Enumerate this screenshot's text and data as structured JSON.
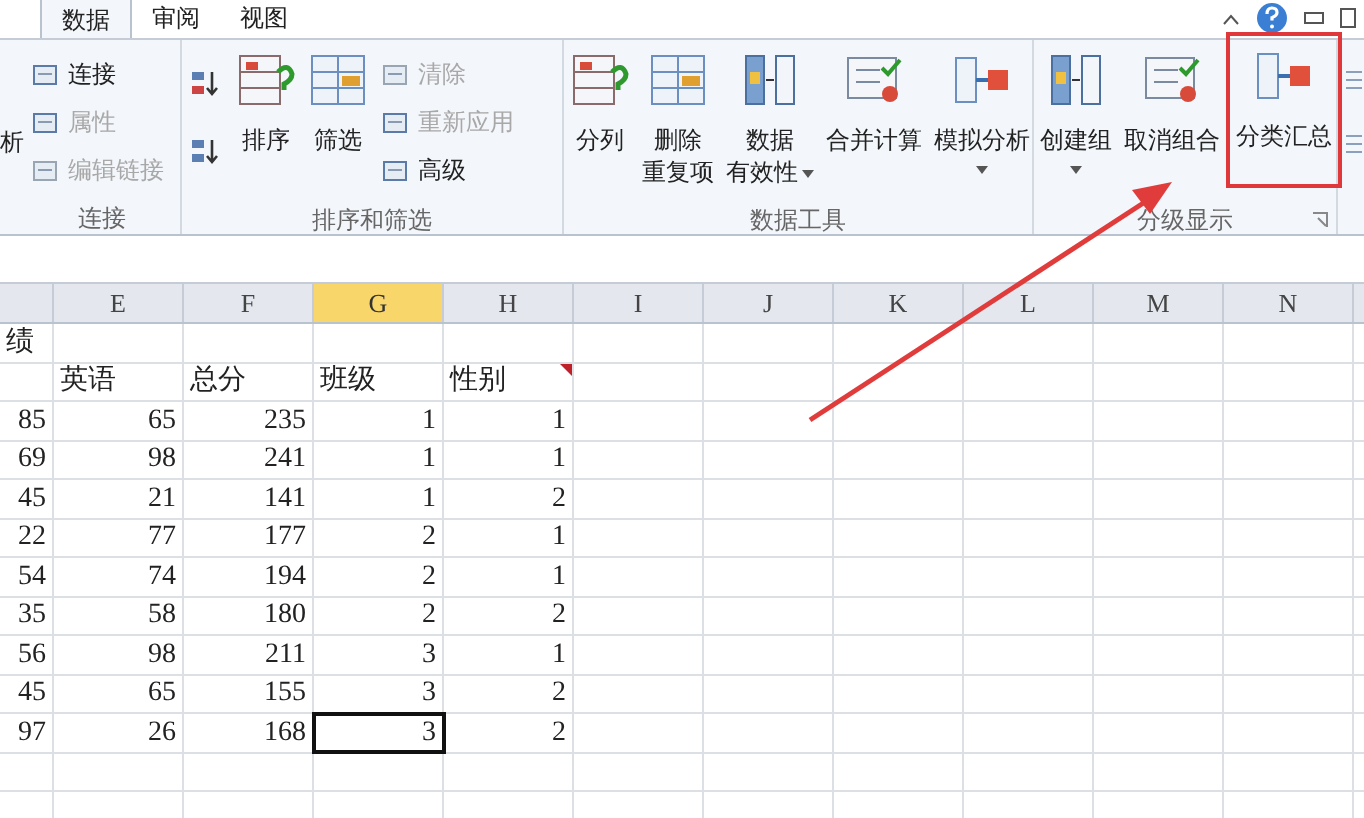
{
  "ribbon": {
    "tabs": [
      {
        "label": "数据",
        "selected": true
      },
      {
        "label": "审阅",
        "selected": false
      },
      {
        "label": "视图",
        "selected": false
      }
    ],
    "cut_label": "析",
    "groups": [
      {
        "label": "连接",
        "items": [
          {
            "kind": "small",
            "label": "连接",
            "disabled": false
          },
          {
            "kind": "small",
            "label": "属性",
            "disabled": true
          },
          {
            "kind": "small",
            "label": "编辑链接",
            "disabled": true
          }
        ]
      },
      {
        "label": "排序和筛选",
        "items": [
          {
            "kind": "icon"
          },
          {
            "kind": "icon"
          },
          {
            "kind": "large",
            "lines": [
              "排序"
            ],
            "dropdown": false,
            "highlighted": false
          },
          {
            "kind": "large",
            "lines": [
              "筛选"
            ],
            "dropdown": false,
            "highlighted": false
          },
          {
            "kind": "small",
            "label": "清除",
            "disabled": true
          },
          {
            "kind": "small",
            "label": "重新应用",
            "disabled": true
          },
          {
            "kind": "small",
            "label": "高级",
            "disabled": false
          }
        ]
      },
      {
        "label": "数据工具",
        "items": [
          {
            "kind": "large",
            "lines": [
              "分列"
            ],
            "dropdown": false,
            "highlighted": false
          },
          {
            "kind": "large",
            "lines": [
              "删除",
              "重复项"
            ],
            "dropdown": false,
            "highlighted": false
          },
          {
            "kind": "large",
            "lines": [
              "数据",
              "有效性"
            ],
            "dropdown": true,
            "highlighted": false
          },
          {
            "kind": "large",
            "lines": [
              "合并计算"
            ],
            "dropdown": false,
            "highlighted": false
          },
          {
            "kind": "large",
            "lines": [
              "模拟分析"
            ],
            "dropdown": true,
            "highlighted": false
          }
        ]
      },
      {
        "label": "分级显示",
        "items": [
          {
            "kind": "large",
            "lines": [
              "创建组"
            ],
            "dropdown": true,
            "highlighted": false
          },
          {
            "kind": "large",
            "lines": [
              "取消组合"
            ],
            "dropdown": false,
            "highlighted": false
          },
          {
            "kind": "large",
            "lines": [
              "分类汇总"
            ],
            "dropdown": false,
            "highlighted": true
          }
        ]
      }
    ]
  },
  "sheet": {
    "columns": [
      {
        "label": "E",
        "selected": false
      },
      {
        "label": "F",
        "selected": false
      },
      {
        "label": "G",
        "selected": true
      },
      {
        "label": "H",
        "selected": false
      },
      {
        "label": "I",
        "selected": false
      },
      {
        "label": "J",
        "selected": false
      },
      {
        "label": "K",
        "selected": false
      },
      {
        "label": "L",
        "selected": false
      },
      {
        "label": "M",
        "selected": false
      },
      {
        "label": "N",
        "selected": false
      }
    ],
    "rows": [
      {
        "cells": [
          "绩",
          "",
          "",
          "",
          ""
        ],
        "selected": false,
        "comment": false
      },
      {
        "cells": [
          "",
          "英语",
          "总分",
          "班级",
          "性别"
        ],
        "selected": false,
        "comment": true
      },
      {
        "cells": [
          "85",
          "65",
          "235",
          "1",
          "1"
        ],
        "selected": false,
        "comment": false
      },
      {
        "cells": [
          "69",
          "98",
          "241",
          "1",
          "1"
        ],
        "selected": false,
        "comment": false
      },
      {
        "cells": [
          "45",
          "21",
          "141",
          "1",
          "2"
        ],
        "selected": false,
        "comment": false
      },
      {
        "cells": [
          "22",
          "77",
          "177",
          "2",
          "1"
        ],
        "selected": false,
        "comment": false
      },
      {
        "cells": [
          "54",
          "74",
          "194",
          "2",
          "1"
        ],
        "selected": false,
        "comment": false
      },
      {
        "cells": [
          "35",
          "58",
          "180",
          "2",
          "2"
        ],
        "selected": false,
        "comment": false
      },
      {
        "cells": [
          "56",
          "98",
          "211",
          "3",
          "1"
        ],
        "selected": false,
        "comment": false
      },
      {
        "cells": [
          "45",
          "65",
          "155",
          "3",
          "2"
        ],
        "selected": false,
        "comment": false
      },
      {
        "cells": [
          "97",
          "26",
          "168",
          "3",
          "2"
        ],
        "selected": true,
        "comment": false
      }
    ]
  }
}
